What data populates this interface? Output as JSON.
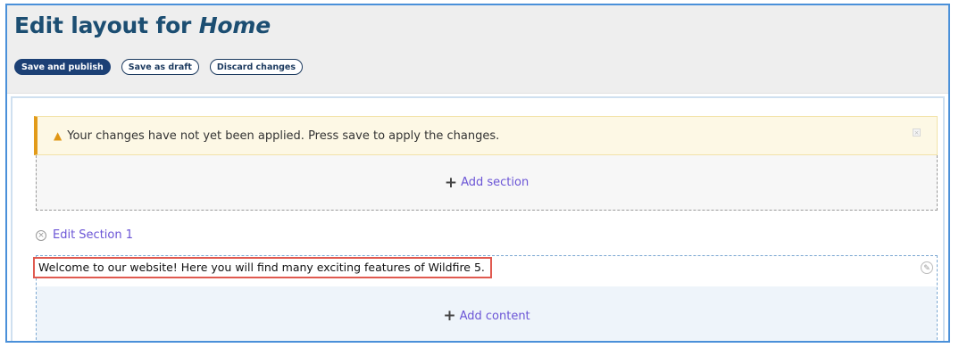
{
  "header": {
    "title_prefix": "Edit layout for",
    "title_page": "Home"
  },
  "toolbar": {
    "save_publish": "Save and publish",
    "save_draft": "Save as draft",
    "discard": "Discard changes"
  },
  "warning": {
    "icon": "warning-triangle-icon",
    "message": "Your changes have not yet been applied. Press save to apply the changes."
  },
  "add_section": {
    "label": "Add section"
  },
  "section": {
    "edit_label": "Edit Section 1",
    "block_text": "Welcome to our website! Here you will find many exciting features of Wildfire 5.",
    "add_content_label": "Add content"
  },
  "colors": {
    "title": "#1c4e72",
    "primary_button": "#1c4075",
    "link": "#6b55d6",
    "warning_accent": "#e29b1a",
    "highlight_border": "#e05a50"
  }
}
